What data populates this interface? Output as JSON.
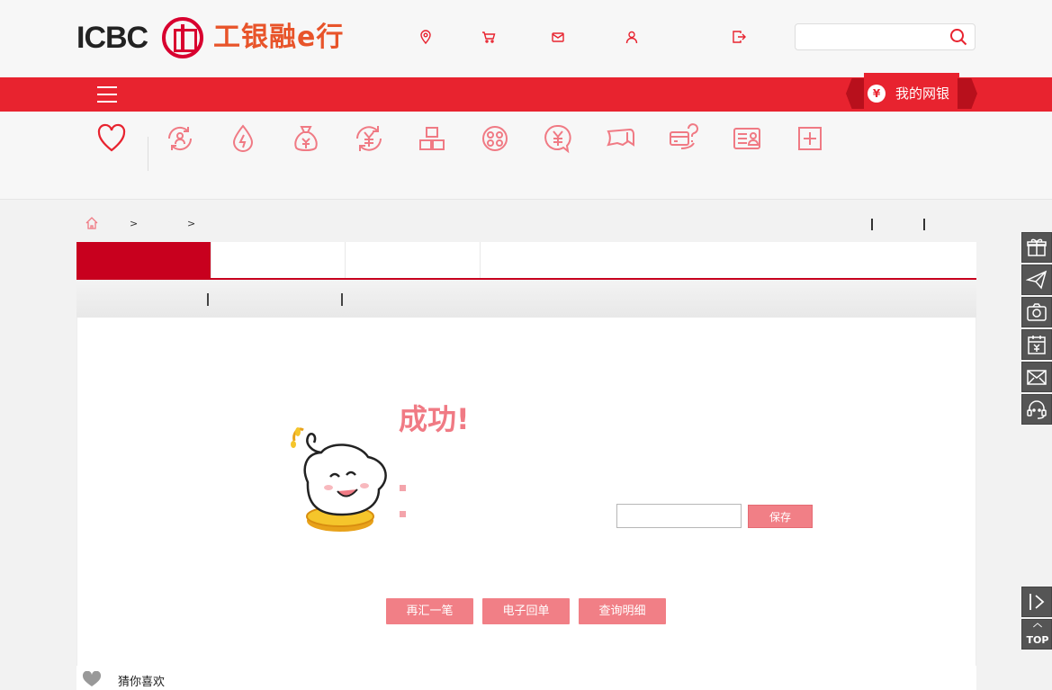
{
  "header": {
    "logo_text": "ICBC",
    "logo_cn": "工银融e行",
    "icons": [
      "location-icon",
      "cart-icon",
      "mail-icon",
      "user-icon",
      "logout-icon"
    ],
    "search": {
      "placeholder": "",
      "value": ""
    }
  },
  "nav": {
    "my_bank_label": "我的网银",
    "my_bank_icon_glyph": "¥"
  },
  "categories": [
    "heart-icon",
    "rotate-account-icon",
    "drop-bolt-icon",
    "money-bag-icon",
    "yuan-refresh-icon",
    "gold-bars-icon",
    "coins-icon",
    "yuan-chat-icon",
    "ticket-icon",
    "card-question-icon",
    "id-card-icon",
    "plus-box-icon"
  ],
  "breadcrumb": {
    "separators": [
      ">",
      ">"
    ]
  },
  "result": {
    "title": "成功!",
    "note_value": "",
    "save_label": "保存",
    "actions": [
      "再汇一笔",
      "电子回单",
      "查询明细"
    ]
  },
  "recommend": {
    "label": "猜你喜欢"
  },
  "floating": [
    "gift-icon",
    "paper-plane-icon",
    "camera-icon",
    "calendar-yuan-icon",
    "envelope-icon",
    "customer-service-icon",
    "collapse-icon",
    "back-to-top-icon"
  ],
  "floating_top_text": "TOP",
  "colors": {
    "brand_red": "#e8232f",
    "tab_red": "#c8001e",
    "accent_pink": "#f17f86",
    "title_pink": "#f07a84"
  }
}
